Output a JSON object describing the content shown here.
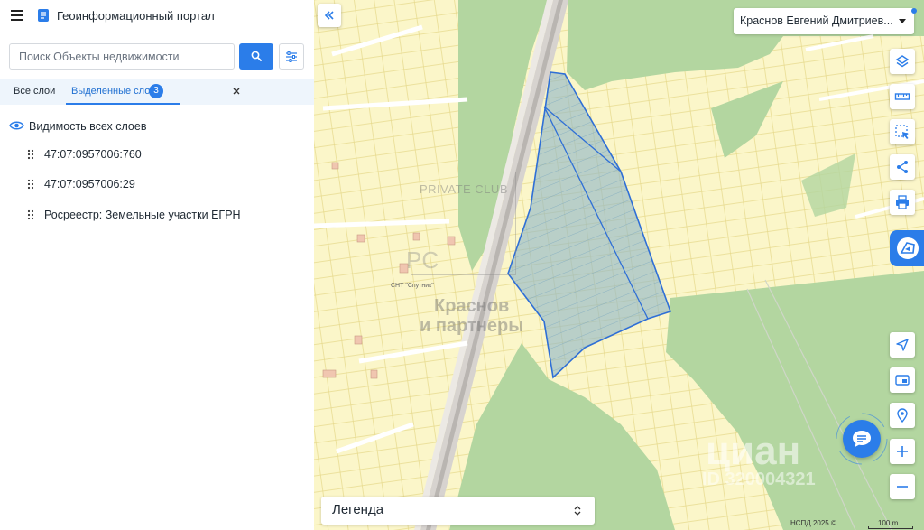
{
  "app": {
    "title": "Геоинформационный портал"
  },
  "search": {
    "placeholder": "Поиск Объекты недвижимости"
  },
  "tabs": {
    "all_label": "Все слои",
    "selected_label": "Выделенные слои",
    "selected_count": "3"
  },
  "layers": {
    "visibility_label": "Видимость всех слоев",
    "items": [
      {
        "label": "47:07:0957006:760"
      },
      {
        "label": "47:07:0957006:29"
      },
      {
        "label": "Росреестр: Земельные участки ЕГРН"
      }
    ]
  },
  "user": {
    "name": "Краснов Евгений Дмитриев..."
  },
  "legend": {
    "label": "Легенда"
  },
  "map": {
    "attribution": "НСПД 2025 ©",
    "scale_label": "100 m",
    "watermarks": {
      "club": "PRIVATE CLUB",
      "club_mark": "PC",
      "agency": "Краснов\nи партнеры",
      "cian": "циан",
      "cian_id": "ID 320004321"
    },
    "place_label": "СНТ \"Спутник\""
  },
  "icons": {
    "menu": "menu-icon",
    "logo": "portal-logo-icon",
    "search": "search-icon",
    "filter": "filter-sliders-icon",
    "eye": "eye-icon",
    "grip": "drag-grip-icon",
    "collapse": "double-chevron-left-icon",
    "layers": "layers-icon",
    "ruler": "ruler-icon",
    "select_area": "select-area-icon",
    "share": "share-icon",
    "print": "print-icon",
    "navigate": "navigate-arrow-icon",
    "minimap": "minimap-icon",
    "location": "location-search-icon",
    "zoom_in": "plus-icon",
    "zoom_out": "minus-icon",
    "chat": "chat-icon"
  },
  "colors": {
    "accent": "#2b7de9",
    "parcel_fill": "#8fb6c8",
    "parcel_stroke": "#2f6fd6",
    "green": "#b3d6a0",
    "yellow": "#fbf6c9"
  }
}
